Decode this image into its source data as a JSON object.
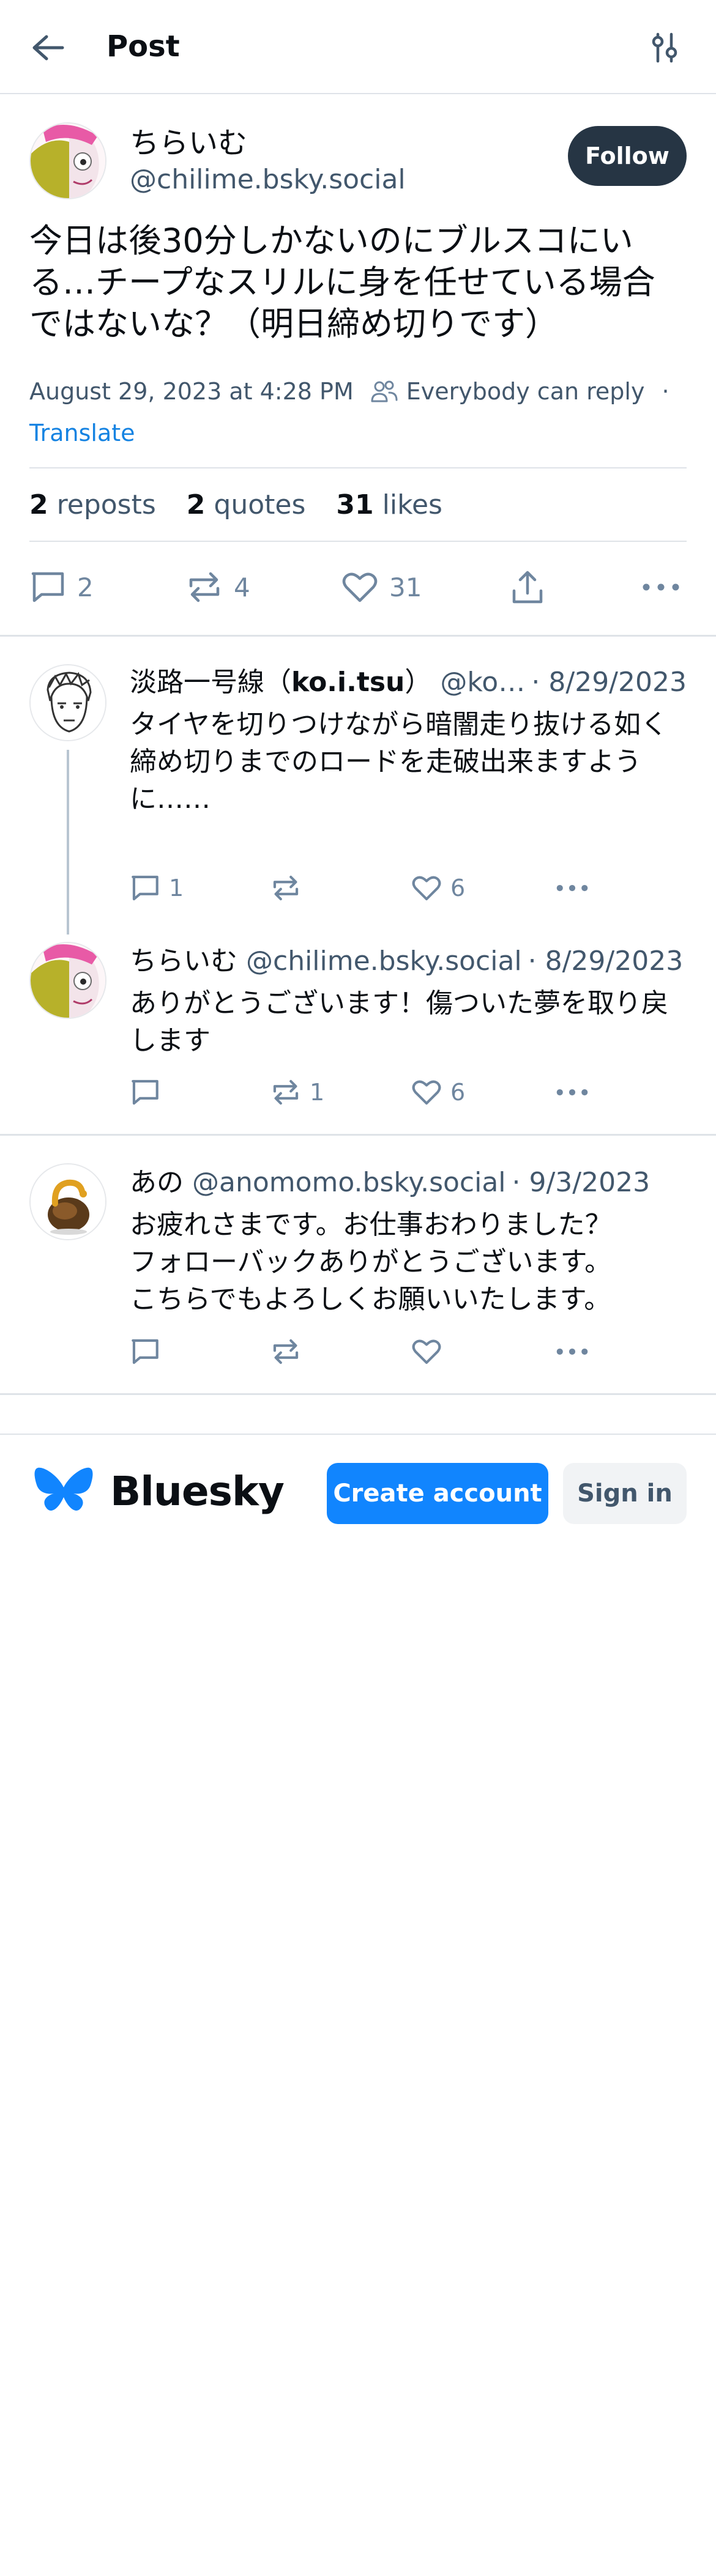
{
  "header": {
    "title": "Post",
    "back_icon": "arrow-left-icon",
    "settings_icon": "sliders-icon"
  },
  "post": {
    "author_name": "ちらいむ",
    "author_handle": "@chilime.bsky.social",
    "follow_label": "Follow",
    "text": "今日は後30分しかないのにブルスコにいる…チープなスリルに身を任せている場合ではないな？（明日締め切りです）",
    "timestamp": "August 29, 2023 at 4:28 PM",
    "reply_setting": "Everybody can reply",
    "separator": "·",
    "translate_label": "Translate",
    "stats": {
      "reposts_count": "2",
      "reposts_label": "reposts",
      "quotes_count": "2",
      "quotes_label": "quotes",
      "likes_count": "31",
      "likes_label": "likes"
    },
    "actions": {
      "reply_count": "2",
      "repost_count": "4",
      "like_count": "31"
    }
  },
  "replies": [
    {
      "name_prefix": "淡路一号線（",
      "name_bold": "ko.i.tsu",
      "name_suffix": "）",
      "handle": "@koitsu.bsky.social",
      "date": "· 8/29/2023",
      "text": "タイヤを切りつけながら暗闇走り抜ける如く\n締め切りまでのロードを走破出来ますように……",
      "reply_count": "1",
      "repost_count": "",
      "like_count": "6"
    },
    {
      "name": "ちらいむ",
      "handle": "@chilime.bsky.social",
      "date": "· 8/29/2023",
      "text": "ありがとうございます！傷ついた夢を取り戻します",
      "reply_count": "",
      "repost_count": "1",
      "like_count": "6"
    },
    {
      "name": "あの",
      "handle": "@anomomo.bsky.social",
      "date": "· 9/3/2023",
      "text": "お疲れさまです。お仕事おわりました？\nフォローバックありがとうございます。\nこちらでもよろしくお願いいたします。",
      "reply_count": "",
      "repost_count": "",
      "like_count": ""
    }
  ],
  "footer": {
    "brand": "Bluesky",
    "create_account_label": "Create account",
    "sign_in_label": "Sign in"
  },
  "colors": {
    "accent": "#1185fe",
    "link": "#1583e2",
    "follow_bg": "#263544",
    "muted_text": "#42576c",
    "icon_gray": "#6f869f"
  }
}
